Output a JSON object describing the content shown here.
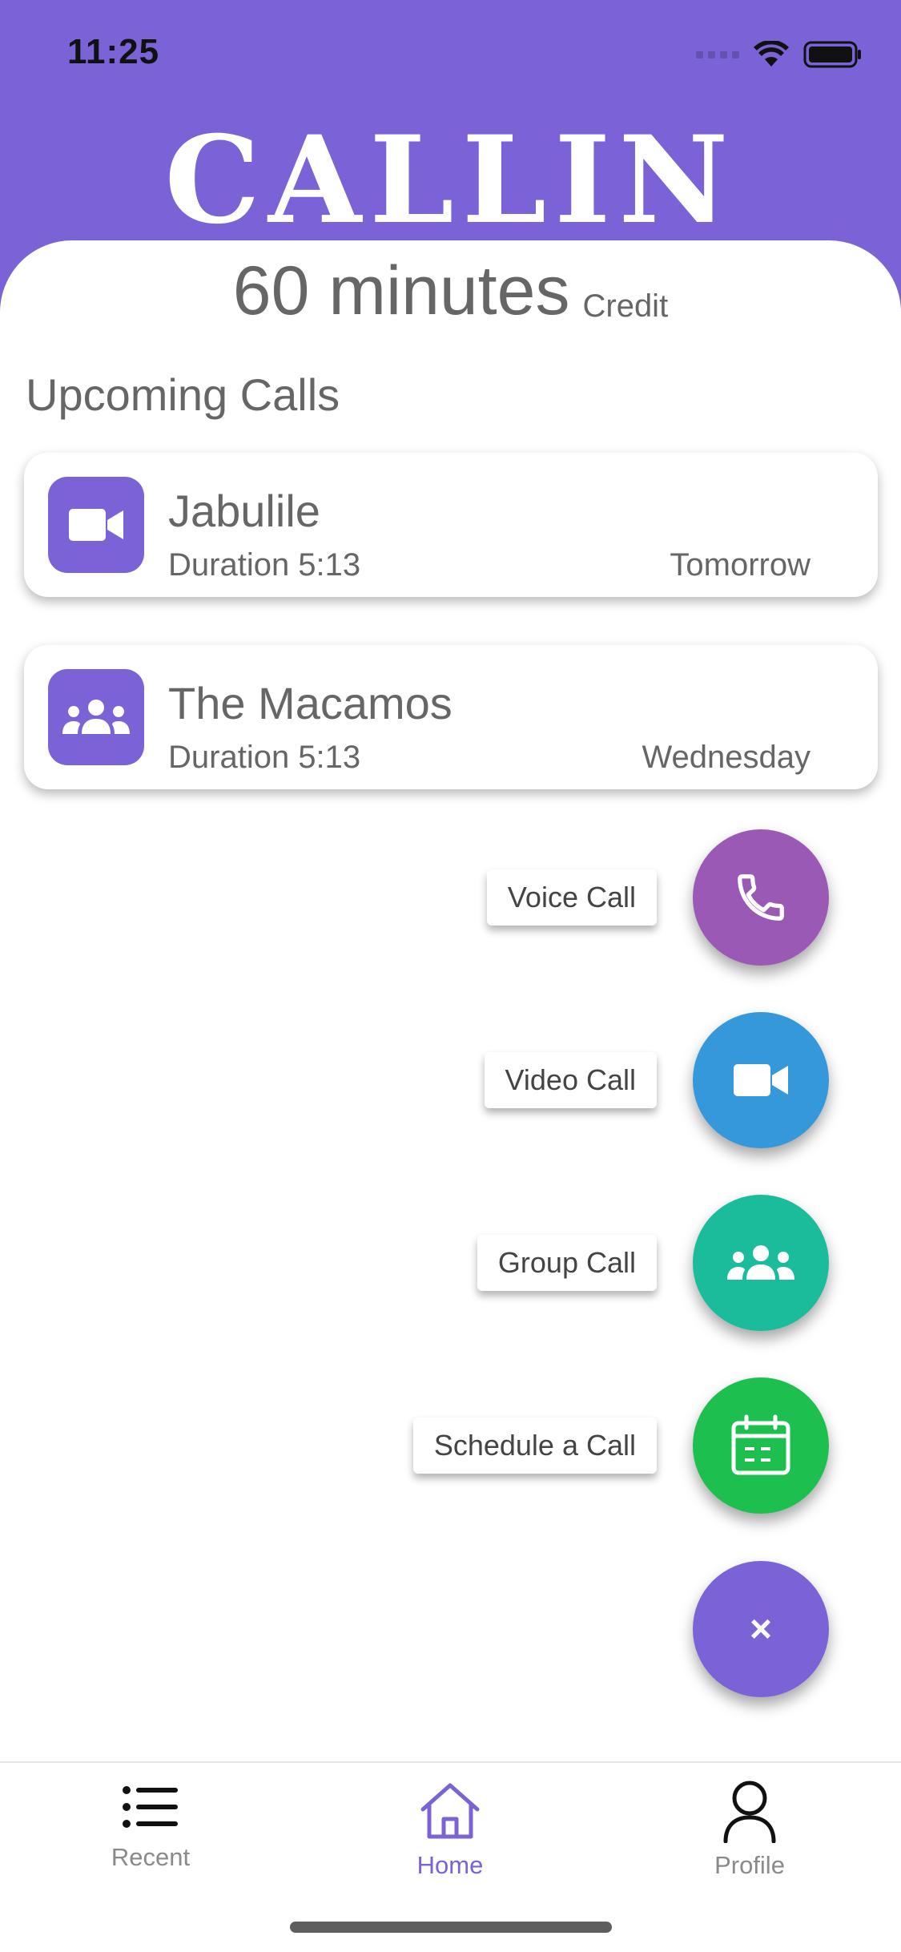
{
  "status_bar": {
    "time": "11:25"
  },
  "app": {
    "logo_text": "CALLIN"
  },
  "credit": {
    "value": "60 minutes",
    "label": "Credit"
  },
  "upcoming": {
    "title": "Upcoming Calls",
    "calls": [
      {
        "name": "Jabulile",
        "duration": "Duration 5:13",
        "when": "Tomorrow",
        "icon": "video-camera-icon"
      },
      {
        "name": "The Macamos",
        "duration": "Duration 5:13",
        "when": "Wednesday",
        "icon": "group-icon"
      }
    ]
  },
  "fab_menu": {
    "actions": [
      {
        "label": "Voice Call",
        "icon": "phone-icon",
        "color": "#9b59b6"
      },
      {
        "label": "Video Call",
        "icon": "video-camera-icon",
        "color": "#3498db"
      },
      {
        "label": "Group Call",
        "icon": "group-icon",
        "color": "#1abc9c"
      },
      {
        "label": "Schedule a Call",
        "icon": "calendar-icon",
        "color": "#1dbf4e"
      }
    ],
    "close_symbol": "×"
  },
  "tabs": [
    {
      "label": "Recent",
      "icon": "list-icon",
      "active": false
    },
    {
      "label": "Home",
      "icon": "home-icon",
      "active": true
    },
    {
      "label": "Profile",
      "icon": "person-icon",
      "active": false
    }
  ],
  "colors": {
    "brand": "#7b63d7",
    "text": "#666666"
  }
}
